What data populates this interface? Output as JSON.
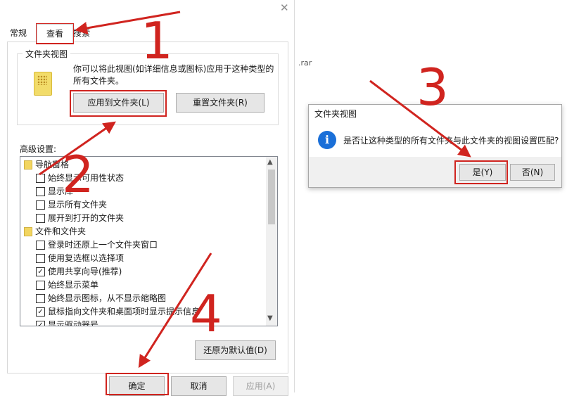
{
  "dialog": {
    "tabs": [
      "常规",
      "查看",
      "搜索"
    ],
    "folder_views": {
      "title": "文件夹视图",
      "description": "你可以将此视图(如详细信息或图标)应用于这种类型的所有文件夹。",
      "apply_button": "应用到文件夹(L)",
      "reset_button": "重置文件夹(R)"
    },
    "advanced_label": "高级设置:",
    "advanced_items": [
      {
        "type": "folder",
        "label": "导航窗格"
      },
      {
        "type": "check",
        "checked": false,
        "label": "始终显示可用性状态"
      },
      {
        "type": "check",
        "checked": false,
        "label": "显示库"
      },
      {
        "type": "check",
        "checked": false,
        "label": "显示所有文件夹"
      },
      {
        "type": "check",
        "checked": false,
        "label": "展开到打开的文件夹"
      },
      {
        "type": "folder",
        "label": "文件和文件夹"
      },
      {
        "type": "check",
        "checked": false,
        "label": "登录时还原上一个文件夹窗口"
      },
      {
        "type": "check",
        "checked": false,
        "label": "使用复选框以选择项"
      },
      {
        "type": "check",
        "checked": true,
        "label": "使用共享向导(推荐)"
      },
      {
        "type": "check",
        "checked": false,
        "label": "始终显示菜单"
      },
      {
        "type": "check",
        "checked": false,
        "label": "始终显示图标，从不显示缩略图"
      },
      {
        "type": "check",
        "checked": true,
        "label": "鼠标指向文件夹和桌面项时显示提示信息"
      },
      {
        "type": "check",
        "checked": true,
        "label": "显示驱动器号"
      }
    ],
    "restore_button": "还原为默认值(D)",
    "ok_button": "确定",
    "cancel_button": "取消",
    "apply_button": "应用(A)"
  },
  "background_text": ".rar",
  "confirm": {
    "title": "文件夹视图",
    "message": "是否让这种类型的所有文件夹与此文件夹的视图设置匹配?",
    "yes_button": "是(Y)",
    "no_button": "否(N)"
  },
  "annotations": [
    "1",
    "2",
    "3",
    "4"
  ],
  "colors": {
    "annotation": "#d0241f",
    "info_icon": "#1a6fd8"
  }
}
